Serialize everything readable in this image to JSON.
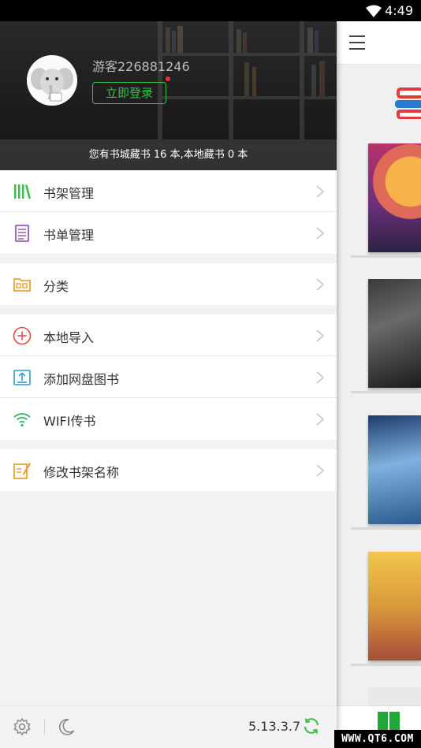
{
  "status_bar": {
    "time": "4:49"
  },
  "header": {
    "username": "游客226881246",
    "login_label": "立即登录",
    "collection_text": "您有书城藏书 16 本,本地藏书 0 本"
  },
  "menu": {
    "group1": [
      {
        "label": "书架管理",
        "icon": "bookshelf-icon"
      },
      {
        "label": "书单管理",
        "icon": "booklist-icon"
      }
    ],
    "group2": [
      {
        "label": "分类",
        "icon": "folder-icon"
      }
    ],
    "group3": [
      {
        "label": "本地导入",
        "icon": "plus-circle-icon"
      },
      {
        "label": "添加网盘图书",
        "icon": "upload-icon"
      },
      {
        "label": "WIFI传书",
        "icon": "wifi-icon"
      }
    ],
    "group4": [
      {
        "label": "修改书架名称",
        "icon": "edit-icon"
      }
    ]
  },
  "footer": {
    "version": "5.13.3.7"
  },
  "watermark": "WWW.QT6.COM",
  "colors": {
    "accent": "#3bbf4a",
    "red_dot": "#ff2a2a"
  }
}
